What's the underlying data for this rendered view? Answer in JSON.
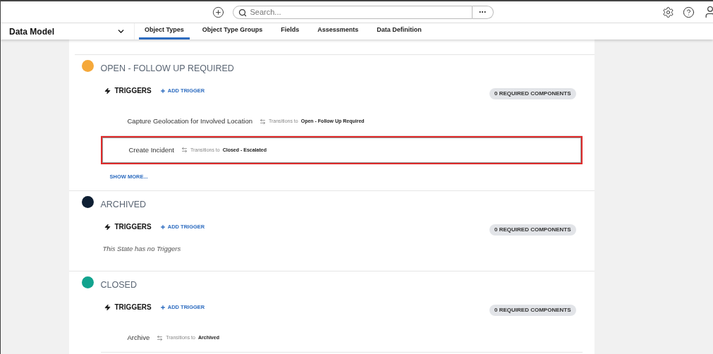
{
  "topbar": {
    "search": {
      "placeholder": "Search..."
    }
  },
  "nav": {
    "title": "Data Model",
    "tabs": [
      {
        "label": "Object Types",
        "selected": true
      },
      {
        "label": "Object Type Groups",
        "selected": false
      },
      {
        "label": "Fields",
        "selected": false
      },
      {
        "label": "Assessments",
        "selected": false
      },
      {
        "label": "Data Definition",
        "selected": false
      }
    ]
  },
  "states": [
    {
      "name": "OPEN - FOLLOW UP REQUIRED",
      "color": "#f5a83a",
      "triggers_label": "TRIGGERS",
      "add_trigger": "ADD TRIGGER",
      "badge": "0 REQUIRED COMPONENTS",
      "triggers": [
        {
          "name": "Capture Geolocation for Involved Location",
          "transition_label": "Transitions to",
          "target": "Open - Follow Up Required",
          "highlighted": false
        },
        {
          "name": "Create Incident",
          "transition_label": "Transitions to",
          "target": "Closed - Escalated",
          "highlighted": true
        }
      ],
      "show_more": "SHOW MORE..."
    },
    {
      "name": "ARCHIVED",
      "color": "#0e1f33",
      "triggers_label": "TRIGGERS",
      "add_trigger": "ADD TRIGGER",
      "badge": "0 REQUIRED COMPONENTS",
      "empty_text": "This State has no Triggers"
    },
    {
      "name": "CLOSED",
      "color": "#12a38e",
      "triggers_label": "TRIGGERS",
      "add_trigger": "ADD TRIGGER",
      "badge": "0 REQUIRED COMPONENTS",
      "triggers": [
        {
          "name": "Archive",
          "transition_label": "Transitions to",
          "target": "Archived",
          "highlighted": false
        }
      ]
    }
  ]
}
